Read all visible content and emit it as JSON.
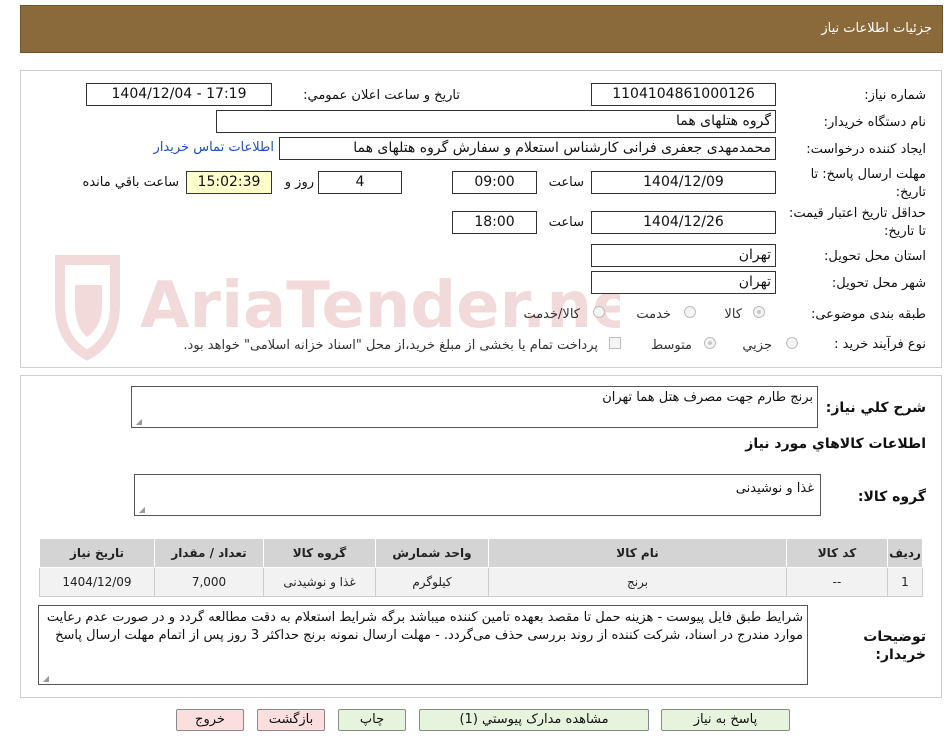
{
  "header": {
    "title": "جزئیات اطلاعات نیاز"
  },
  "watermark": {
    "text": "AriaTender.neT",
    "color": "#b81e1e"
  },
  "form": {
    "need_number_label": "شماره نیاز:",
    "need_number": "1104104861000126",
    "announce_label": "تاريخ و ساعت اعلان عمومي:",
    "announce_value": "1404/12/04 - 17:19",
    "buyer_org_label": "نام دستگاه خريدار:",
    "buyer_org": "گروه هتلهای هما",
    "creator_label": "ايجاد کننده درخواست:",
    "creator": "محمدمهدی جعفری فرانی کارشناس استعلام و سفارش گروه هتلهای هما",
    "contact_link": "اطلاعات تماس خريدار",
    "deadline_label": "مهلت ارسال پاسخ: تا تاريخ:",
    "deadline_date": "1404/12/09",
    "time_label": "ساعت",
    "deadline_time": "09:00",
    "days": "4",
    "days_label": "روز و",
    "remaining_time": "15:02:39",
    "remaining_label": "ساعت باقي مانده",
    "validity_label": "حداقل تاريخ اعتبار قيمت: تا تاريخ:",
    "validity_date": "1404/12/26",
    "validity_time": "18:00",
    "province_label": "استان محل تحويل:",
    "province": "تهران",
    "city_label": "شهر محل تحويل:",
    "city": "تهران",
    "category_label": "طبقه بندی موضوعی:",
    "category_options": [
      "کالا",
      "خدمت",
      "کالا/خدمت"
    ],
    "process_label": "نوع فرآيند خريد :",
    "process_options": [
      "جزيي",
      "متوسط"
    ],
    "payment_note": "پرداخت تمام يا بخشی از مبلغ خريد،از محل \"اسناد خزانه اسلامی\" خواهد بود."
  },
  "summary": {
    "desc_label": "شرح کلي نياز:",
    "desc_value": "برنج طارم جهت مصرف هتل هما تهران",
    "goods_title": "اطلاعات کالاهاي مورد نياز",
    "group_label": "گروه کالا:",
    "group_value": "غذا و نوشیدنی",
    "table": {
      "headers": [
        "رديف",
        "کد کالا",
        "نام کالا",
        "واحد شمارش",
        "گروه کالا",
        "تعداد / مقدار",
        "تاريخ نياز"
      ],
      "rows": [
        [
          "1",
          "--",
          "برنج",
          "کیلوگرم",
          "غذا و نوشیدنی",
          "7,000",
          "1404/12/09"
        ]
      ]
    },
    "notes_label": "توضيحات خريدار:",
    "notes_value": "شرایط طبق فایل پیوست - هزینه حمل تا مقصد بعهده تامین کننده میباشد برگه شرایط استعلام به دقت مطالعه گردد و در صورت عدم رعایت موارد مندرج در اسناد، شرکت کننده از روند بررسی حذف می‌گردد. - مهلت ارسال نمونه برنج حداکثر 3 روز پس از اتمام مهلت ارسال پاسخ"
  },
  "buttons": {
    "reply": "پاسخ به نياز",
    "view_docs": "مشاهده مدارک پيوستي (1)",
    "print": "چاپ",
    "back": "بازگشت",
    "exit": "خروج"
  }
}
